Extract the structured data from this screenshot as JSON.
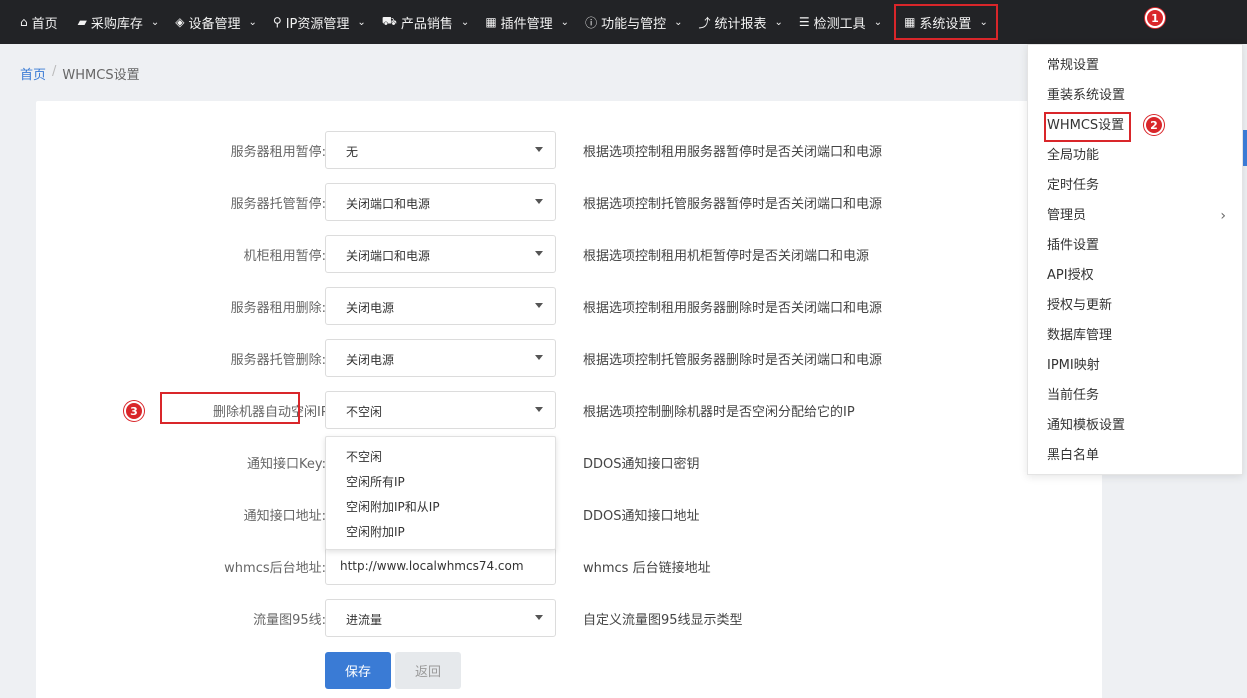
{
  "nav": {
    "items": [
      {
        "label": "首页",
        "icon": "home-icon",
        "glyph": "⌂"
      },
      {
        "label": "采购库存",
        "icon": "truck-icon",
        "glyph": "▰"
      },
      {
        "label": "设备管理",
        "icon": "cube-icon",
        "glyph": "◈"
      },
      {
        "label": "IP资源管理",
        "icon": "location-pin-icon",
        "glyph": "⚲"
      },
      {
        "label": "产品销售",
        "icon": "cart-icon",
        "glyph": "⛟"
      },
      {
        "label": "插件管理",
        "icon": "grid-icon",
        "glyph": "▦"
      },
      {
        "label": "功能与管控",
        "icon": "info-icon",
        "glyph": "ⓘ"
      },
      {
        "label": "统计报表",
        "icon": "line-chart-icon",
        "glyph": "⤴"
      },
      {
        "label": "检测工具",
        "icon": "list-icon",
        "glyph": "☰"
      },
      {
        "label": "系统设置",
        "icon": "windows-grid-icon",
        "glyph": "▦"
      }
    ]
  },
  "breadcrumb": {
    "home": "首页",
    "separator": "/",
    "current": "WHMCS设置"
  },
  "form": {
    "rows": [
      {
        "label": "服务器租用暂停:",
        "value": "无",
        "help": "根据选项控制租用服务器暂停时是否关闭端口和电源"
      },
      {
        "label": "服务器托管暂停:",
        "value": "关闭端口和电源",
        "help": "根据选项控制托管服务器暂停时是否关闭端口和电源"
      },
      {
        "label": "机柜租用暂停:",
        "value": "关闭端口和电源",
        "help": "根据选项控制租用机柜暂停时是否关闭端口和电源"
      },
      {
        "label": "服务器租用删除:",
        "value": "关闭电源",
        "help": "根据选项控制租用服务器删除时是否关闭端口和电源"
      },
      {
        "label": "服务器托管删除:",
        "value": "关闭电源",
        "help": "根据选项控制托管服务器删除时是否关闭端口和电源"
      },
      {
        "label": "删除机器自动空闲IP:",
        "value": "不空闲",
        "help": "根据选项控制删除机器时是否空闲分配给它的IP"
      },
      {
        "label": "通知接口Key:",
        "value": "",
        "help": "DDOS通知接口密钥"
      },
      {
        "label": "通知接口地址:",
        "value": "",
        "help": "DDOS通知接口地址"
      },
      {
        "label": "whmcs后台地址:",
        "value": "http://www.localwhmcs74.com",
        "help": "whmcs 后台链接地址"
      },
      {
        "label": "流量图95线:",
        "value": "进流量",
        "help": "自定义流量图95线显示类型"
      }
    ],
    "dropdown_options": [
      "不空闲",
      "空闲所有IP",
      "空闲附加IP和从IP",
      "空闲附加IP"
    ],
    "save_label": "保存",
    "back_label": "返回"
  },
  "submenu": {
    "items": [
      "常规设置",
      "重装系统设置",
      "WHMCS设置",
      "全局功能",
      "定时任务",
      "管理员",
      "插件设置",
      "API授权",
      "授权与更新",
      "数据库管理",
      "IPMI映射",
      "当前任务",
      "通知模板设置",
      "黑白名单"
    ]
  },
  "badges": [
    "1",
    "2",
    "3"
  ],
  "colors": {
    "nav_bg": "#222326",
    "accent": "#3a7bd5",
    "annotation_red": "#d9262a"
  }
}
